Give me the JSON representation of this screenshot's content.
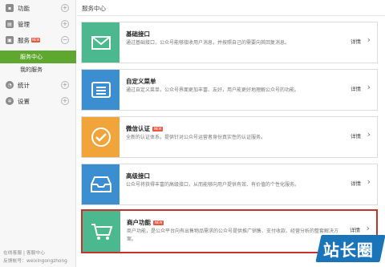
{
  "sidebar": {
    "groups": [
      {
        "label": "功能",
        "icon": "function-icon"
      },
      {
        "label": "管理",
        "icon": "manage-icon"
      },
      {
        "label": "服务",
        "icon": "service-icon",
        "badge": "NEW"
      },
      {
        "label": "统计",
        "icon": "stats-icon"
      },
      {
        "label": "设置",
        "icon": "settings-icon"
      }
    ],
    "sub_items": [
      {
        "label": "服务中心",
        "active": true
      },
      {
        "label": "我的服务",
        "active": false
      }
    ],
    "footer": {
      "links": "在线客服 | 客服中心",
      "account_label": "反馈帐号：",
      "account_value": "weixingongzhong"
    }
  },
  "main": {
    "title": "服务中心",
    "cards": [
      {
        "title": "基础接口",
        "desc": "通过基础接口，公众号能够接收用户消息，并按照自己的需要向其回复消息。",
        "detail": "详情",
        "icon": "message-icon",
        "color": "#4cb88f"
      },
      {
        "title": "自定义菜单",
        "desc": "通过自定义菜单，公众号界面更加丰富、友好，用户能更好地理解公众号的功能。",
        "detail": "详情",
        "icon": "menu-icon",
        "color": "#3b8fd0"
      },
      {
        "title": "微信认证",
        "badge": "NEW",
        "desc": "全新的认证体系，提供针对公众号运营者身份真实性的认证服务。",
        "detail": "详情",
        "icon": "check-badge-icon",
        "color": "#f0a43a"
      },
      {
        "title": "高级接口",
        "desc": "公众号将获得丰富的高级接口，从而能够向用户提供有效、有价值的个性化服务。",
        "detail": "详情",
        "icon": "inbox-tray-icon",
        "color": "#3b8fd0"
      },
      {
        "title": "商户功能",
        "badge": "NEW",
        "desc": "商户功能，是公众平台向有出售物品需求的公众号提供推广销售、支付收款、经营分析的整套解决方案。",
        "detail": "详情",
        "icon": "cart-icon",
        "color": "#4cb88f",
        "selected": true
      }
    ]
  },
  "watermark": "站长圈"
}
